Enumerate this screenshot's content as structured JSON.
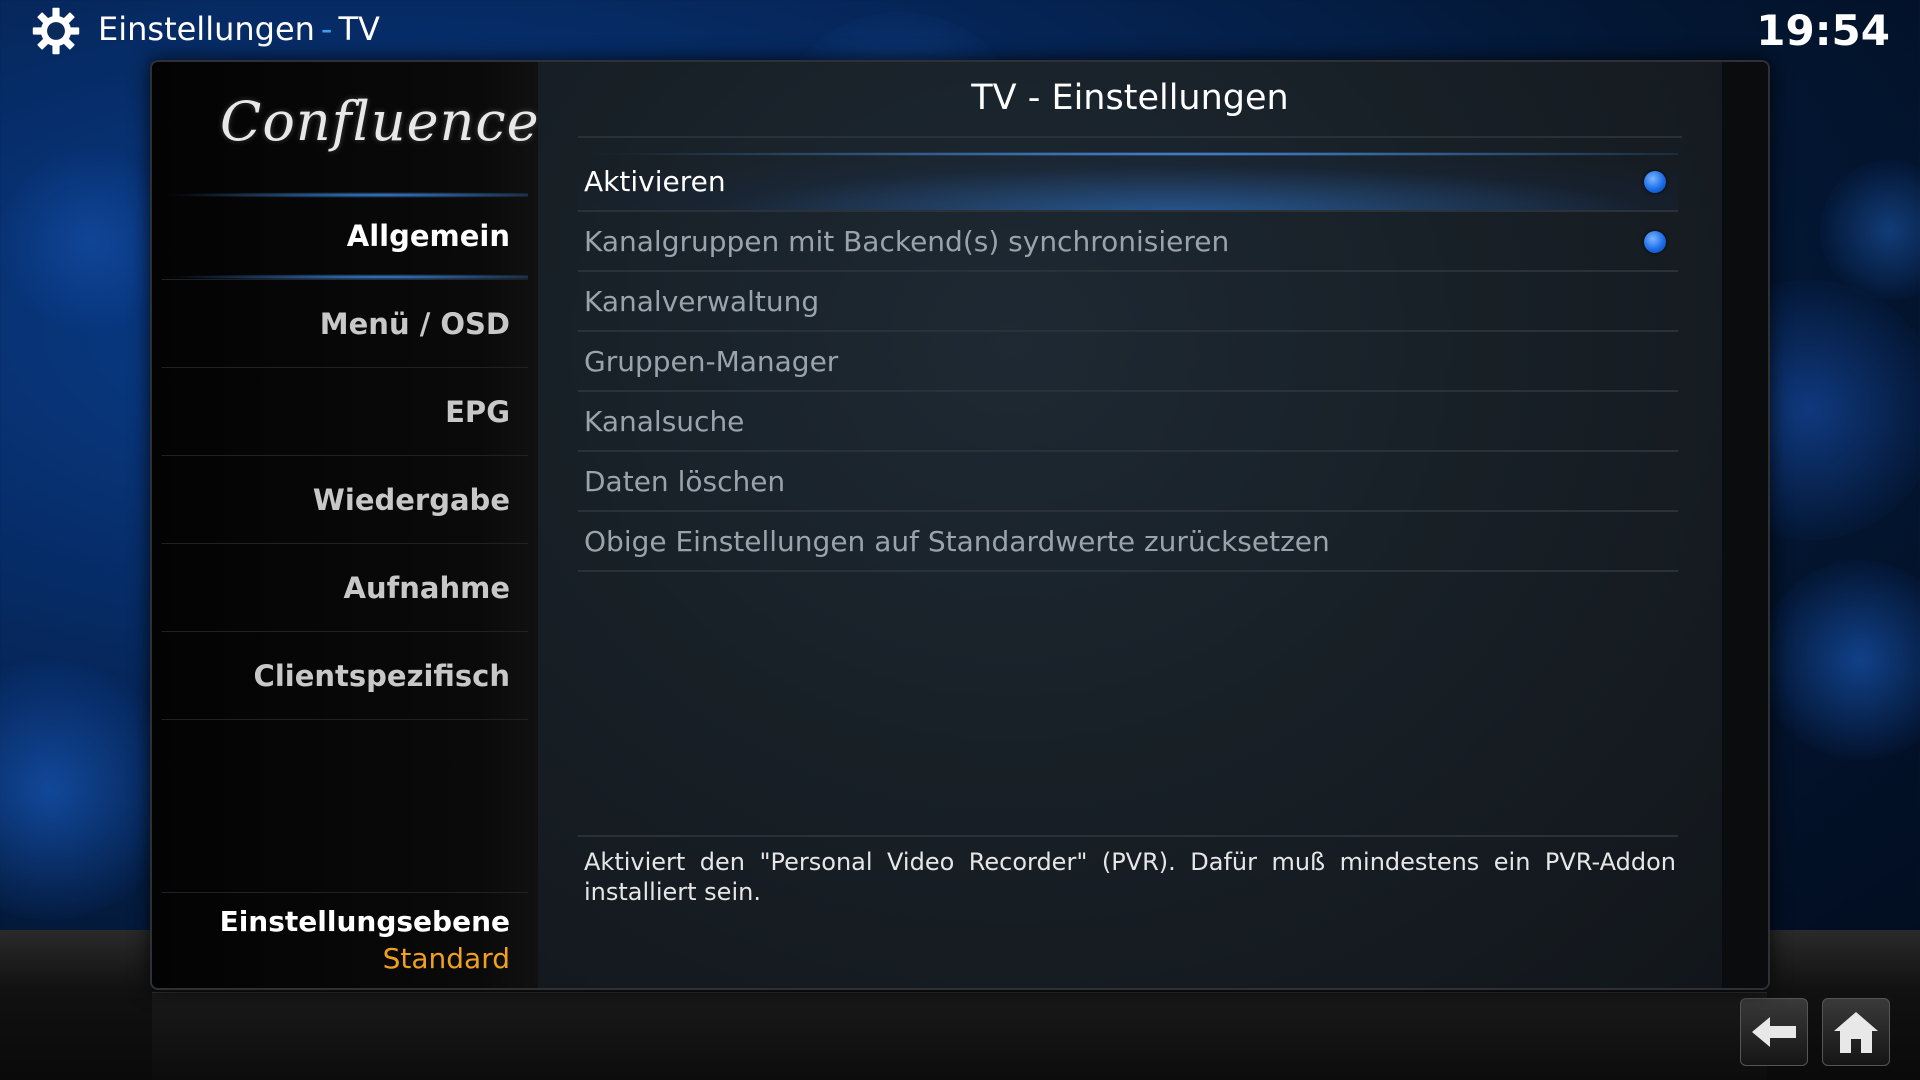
{
  "header": {
    "section": "Einstellungen",
    "separator": "-",
    "subsection": "TV",
    "clock": "19:54"
  },
  "dialog": {
    "logo": "Confluence",
    "title": "TV - Einstellungen",
    "close_label": "✕",
    "categories": [
      {
        "label": "Allgemein",
        "active": true
      },
      {
        "label": "Menü / OSD"
      },
      {
        "label": "EPG"
      },
      {
        "label": "Wiedergabe"
      },
      {
        "label": "Aufnahme"
      },
      {
        "label": "Clientspezifisch"
      }
    ],
    "settings_level": {
      "label": "Einstellungsebene",
      "value": "Standard"
    },
    "settings": [
      {
        "label": "Aktivieren",
        "radio": true,
        "focused": true
      },
      {
        "label": "Kanalgruppen mit Backend(s) synchronisieren",
        "radio": true
      },
      {
        "label": "Kanalverwaltung"
      },
      {
        "label": "Gruppen-Manager"
      },
      {
        "label": "Kanalsuche"
      },
      {
        "label": "Daten löschen"
      },
      {
        "label": "Obige Einstellungen auf Standardwerte zurücksetzen"
      }
    ],
    "description": "Aktiviert den \"Personal Video Recorder\" (PVR). Dafür muß mindestens ein PVR-Addon installiert sein."
  },
  "footer": {
    "back_icon": "back-arrow-icon",
    "home_icon": "home-icon"
  },
  "colors": {
    "accent_blue": "#3c9cf0",
    "level_orange": "#f0a020",
    "radio_blue": "#1b6ee8"
  }
}
